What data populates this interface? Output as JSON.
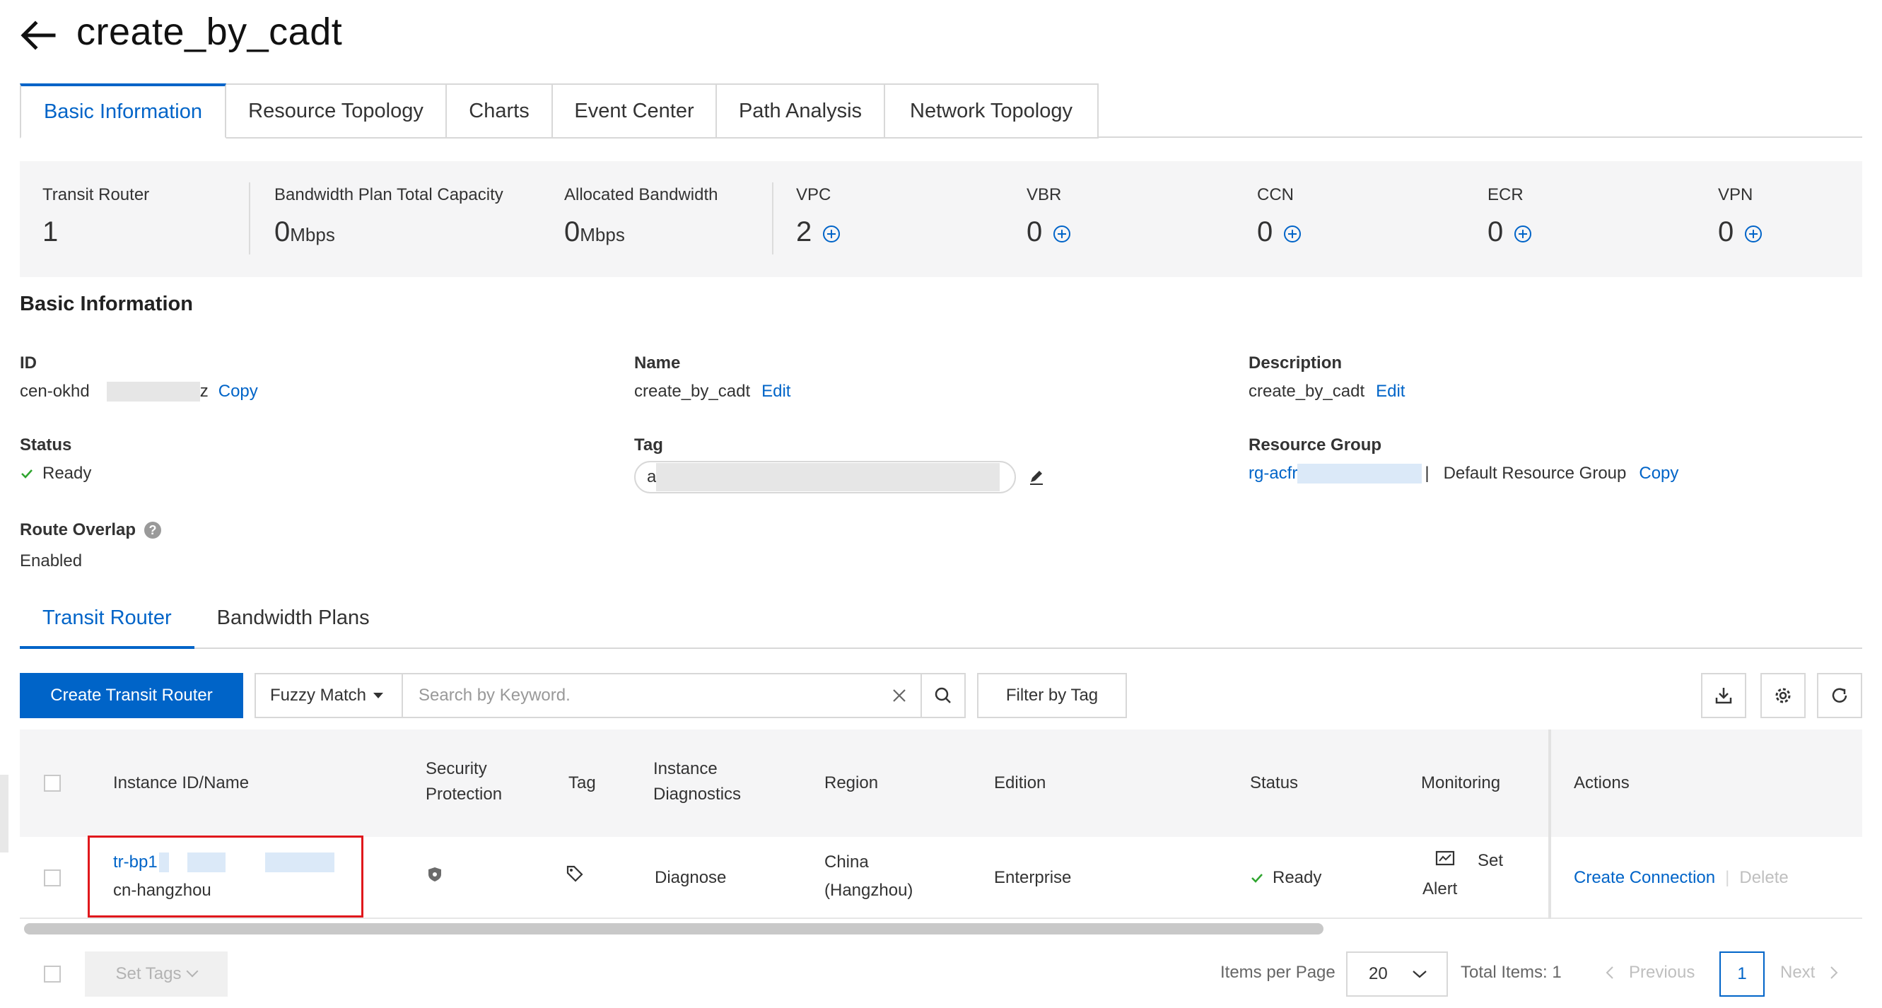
{
  "header": {
    "title": "create_by_cadt"
  },
  "tabs": [
    "Basic Information",
    "Resource Topology",
    "Charts",
    "Event Center",
    "Path Analysis",
    "Network Topology"
  ],
  "stats": {
    "transit_router": {
      "label": "Transit Router",
      "value": "1"
    },
    "bandwidth_plan": {
      "label": "Bandwidth Plan Total Capacity",
      "value": "0",
      "unit": "Mbps"
    },
    "allocated_bandwidth": {
      "label": "Allocated Bandwidth",
      "value": "0",
      "unit": "Mbps"
    },
    "vpc": {
      "label": "VPC",
      "value": "2"
    },
    "vbr": {
      "label": "VBR",
      "value": "0"
    },
    "ccn": {
      "label": "CCN",
      "value": "0"
    },
    "ecr": {
      "label": "ECR",
      "value": "0"
    },
    "vpn": {
      "label": "VPN",
      "value": "0"
    }
  },
  "basic_info": {
    "section_title": "Basic Information",
    "id_label": "ID",
    "id_prefix": "cen-okhd",
    "id_suffix": "z",
    "copy_label": "Copy",
    "name_label": "Name",
    "name_value": "create_by_cadt",
    "edit_label": "Edit",
    "description_label": "Description",
    "description_value": "create_by_cadt",
    "status_label": "Status",
    "status_value": "Ready",
    "tag_label": "Tag",
    "tag_prefix": "a",
    "resource_group_label": "Resource Group",
    "resource_group_id_prefix": "rg-acfr",
    "resource_group_separator": "|",
    "resource_group_name": "Default Resource Group",
    "route_overlap_label": "Route Overlap",
    "route_overlap_help": "?",
    "route_overlap_value": "Enabled"
  },
  "sub_tabs": [
    "Transit Router",
    "Bandwidth Plans"
  ],
  "toolbar": {
    "create_label": "Create Transit Router",
    "match_mode": "Fuzzy Match",
    "search_placeholder": "Search by Keyword.",
    "filter_tag_label": "Filter by Tag"
  },
  "table": {
    "headers": {
      "instance": "Instance ID/Name",
      "security_1": "Security",
      "security_2": "Protection",
      "tag": "Tag",
      "diag_1": "Instance",
      "diag_2": "Diagnostics",
      "region": "Region",
      "edition": "Edition",
      "status": "Status",
      "monitoring": "Monitoring",
      "actions": "Actions"
    },
    "row": {
      "instance_id_prefix": "tr-bp1",
      "instance_name": "cn-hangzhou",
      "diagnose": "Diagnose",
      "region_1": "China",
      "region_2": "(Hangzhou)",
      "edition": "Enterprise",
      "status": "Ready",
      "set_label": "Set",
      "alert_label": "Alert",
      "create_connection": "Create Connection",
      "separator": "|",
      "delete": "Delete"
    }
  },
  "footer": {
    "set_tags": "Set Tags",
    "items_per_page_label": "Items per Page",
    "items_per_page": "20",
    "total_items": "Total Items: 1",
    "previous": "Previous",
    "current_page": "1",
    "next": "Next"
  },
  "colors": {
    "accent": "#0064c8",
    "success": "#2fa52f",
    "highlight": "#e0181c"
  }
}
